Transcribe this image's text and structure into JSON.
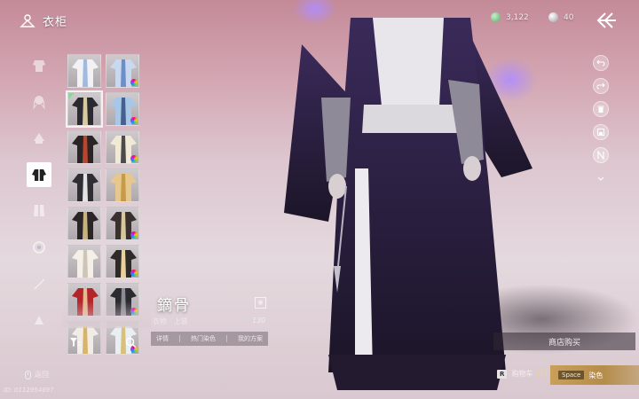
{
  "header": {
    "title": "衣柜",
    "currency_jade": "3,122",
    "currency_silver": "40"
  },
  "categories": [
    {
      "icon": "robe-icon",
      "active": false
    },
    {
      "icon": "hair-icon",
      "active": false
    },
    {
      "icon": "headwear-icon",
      "active": false
    },
    {
      "icon": "outfit-icon",
      "active": true
    },
    {
      "icon": "boots-icon",
      "active": false
    },
    {
      "icon": "accessory-icon",
      "active": false
    },
    {
      "icon": "weapon-skin-icon",
      "active": false
    },
    {
      "icon": "pet-icon",
      "active": false
    }
  ],
  "outfits": [
    {
      "colors": [
        "#f2f2f4",
        "#9fb9e0"
      ],
      "dye": false,
      "new": false,
      "selected": false
    },
    {
      "colors": [
        "#c8d8ee",
        "#6d8fc8"
      ],
      "dye": true,
      "new": false,
      "selected": false
    },
    {
      "colors": [
        "#2a2a30",
        "#d7c9a0"
      ],
      "dye": false,
      "new": true,
      "selected": true
    },
    {
      "colors": [
        "#a8c6e6",
        "#45608f"
      ],
      "dye": true,
      "new": false,
      "selected": false
    },
    {
      "colors": [
        "#2b2425",
        "#b7452f"
      ],
      "dye": false,
      "new": false,
      "selected": false
    },
    {
      "colors": [
        "#f0e9d5",
        "#4b4b4b"
      ],
      "dye": true,
      "new": false,
      "selected": false
    },
    {
      "colors": [
        "#2f2f33",
        "#e3e3e3"
      ],
      "dye": false,
      "new": false,
      "selected": false
    },
    {
      "colors": [
        "#e6c88f",
        "#c79a48"
      ],
      "dye": false,
      "new": false,
      "selected": false
    },
    {
      "colors": [
        "#2a2628",
        "#c9b37c"
      ],
      "dye": false,
      "new": false,
      "selected": false
    },
    {
      "colors": [
        "#3a3030",
        "#d8c89a"
      ],
      "dye": true,
      "new": false,
      "selected": false
    },
    {
      "colors": [
        "#f4efe9",
        "#cfc5b6"
      ],
      "dye": false,
      "new": false,
      "selected": false
    },
    {
      "colors": [
        "#2f2a2a",
        "#e8d29a"
      ],
      "dye": true,
      "new": false,
      "selected": false
    },
    {
      "colors": [
        "#b2262a",
        "#e6b98f"
      ],
      "dye": false,
      "new": false,
      "selected": false
    },
    {
      "colors": [
        "#2b2b2f",
        "#8b8b95"
      ],
      "dye": true,
      "new": false,
      "selected": false
    },
    {
      "colors": [
        "#f1ece6",
        "#d6b46a"
      ],
      "dye": false,
      "new": false,
      "selected": false
    },
    {
      "colors": [
        "#e9eef3",
        "#d8c07a"
      ],
      "dye": true,
      "new": false,
      "selected": false
    }
  ],
  "item": {
    "name": "鏑骨",
    "subtitle": "衣物 · 上装",
    "score": "130",
    "mark": "※"
  },
  "info_tabs": [
    "详情",
    "热门染色",
    "我的方案"
  ],
  "tools": [
    "undo-icon",
    "redo-icon",
    "trash-icon",
    "save-icon",
    "gender-icon",
    "more-icon"
  ],
  "actions": {
    "shop": "商店购买",
    "back": "返回",
    "cart_key": "R",
    "cart": "购物车",
    "cart_count": "(2)",
    "dye_key": "Space",
    "dye": "染色"
  },
  "player_id": "ID: 0112954697"
}
